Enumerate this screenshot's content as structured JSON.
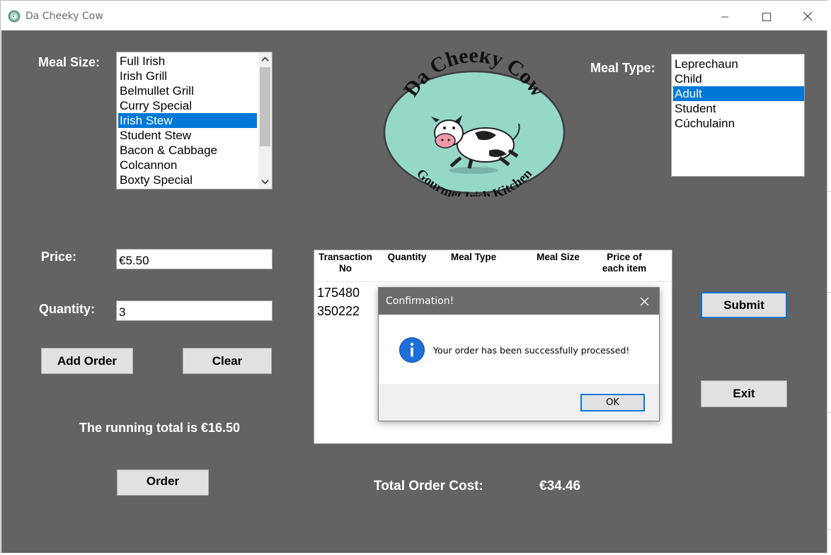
{
  "window": {
    "title": "Da Cheeky Cow"
  },
  "meal_size": {
    "label": "Meal Size:",
    "items": [
      "Full Irish",
      "Irish Grill",
      "Belmullet Grill",
      "Curry Special",
      "Irish Stew",
      "Student Stew",
      "Bacon & Cabbage",
      "Colcannon",
      "Boxty Special"
    ],
    "selected": "Irish Stew"
  },
  "meal_type": {
    "label": "Meal Type:",
    "items": [
      "Leprechaun",
      "Child",
      "Adult",
      "Student",
      "Cúchulainn"
    ],
    "selected": "Adult"
  },
  "logo": {
    "top_text": "Da Cheeky Cow",
    "bottom_text": "Gourmet Irish Kitchen"
  },
  "price": {
    "label": "Price:",
    "value": "€5.50"
  },
  "quantity": {
    "label": "Quantity:",
    "value": "3"
  },
  "buttons": {
    "add_order": "Add Order",
    "clear": "Clear",
    "order": "Order",
    "submit": "Submit",
    "exit": "Exit"
  },
  "running_total": "The running total is €16.50",
  "orders_table": {
    "headers": [
      "Transaction No",
      "Quantity",
      "Meal Type",
      "Meal Size",
      "Price of each item"
    ],
    "rows": [
      "175480",
      "350222"
    ]
  },
  "total_order_cost": {
    "label": "Total Order Cost:",
    "value": "€34.46"
  },
  "dialog": {
    "title": "Confirmation!",
    "message": "Your order has been successfully processed!",
    "ok_label": "OK"
  },
  "colors": {
    "background": "#636363",
    "selection": "#0078d7",
    "logo_teal": "#96d8c8"
  }
}
